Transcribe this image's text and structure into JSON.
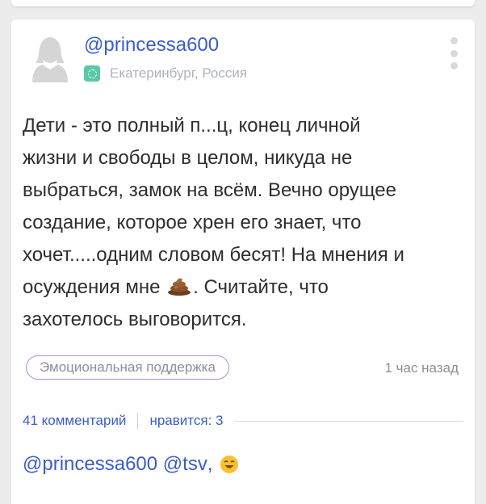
{
  "post": {
    "author": "@princessa600",
    "location": "Екатеринбург, Россия",
    "text_part1": "Дети - это полный п...ц, конец личной\nжизни и свободы в целом, никуда не\nвыбраться, замок на всём. Вечно орущее\nсоздание, которое хрен его знает, что\nхочет.....одним словом бесят! На мнения и\nосуждения мне ",
    "text_part2": ". Считайте, что\nзахотелось выговорится.",
    "tag": "Эмоциональная поддержка",
    "time": "1 час назад",
    "comments": "41 комментарий",
    "likes": "нравится: 3"
  },
  "reply": {
    "author": "@princessa600",
    "mention": "@tsv",
    "punct": ","
  },
  "colors": {
    "link": "#3a5dc9",
    "tag_border": "#b78bd6",
    "location_icon": "#58c9a6"
  },
  "icons": [
    "avatar-placeholder-icon",
    "location-icon",
    "more-vertical-icon",
    "poop-emoji-icon",
    "smile-emoji-icon"
  ]
}
